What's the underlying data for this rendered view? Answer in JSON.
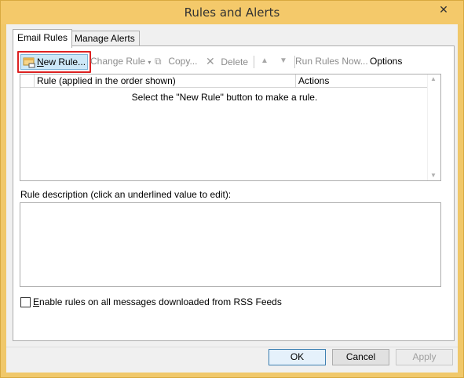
{
  "window": {
    "title": "Rules and Alerts",
    "close_icon": "close-icon"
  },
  "tabs": [
    {
      "label": "Email Rules",
      "active": true
    },
    {
      "label": "Manage Alerts",
      "active": false
    }
  ],
  "toolbar": {
    "new_rule": "New Rule...",
    "change_rule": "Change Rule",
    "copy": "Copy...",
    "delete": "Delete",
    "run_rules_now": "Run Rules Now...",
    "options": "Options"
  },
  "rules_list": {
    "columns": [
      "Rule (applied in the order shown)",
      "Actions"
    ],
    "empty_message": "Select the \"New Rule\" button to make a rule."
  },
  "rule_description": {
    "label": "Rule description (click an underlined value to edit):"
  },
  "rss_checkbox": {
    "label": "Enable rules on all messages downloaded from RSS Feeds",
    "checked": false
  },
  "buttons": {
    "ok": "OK",
    "cancel": "Cancel",
    "apply": "Apply"
  },
  "colors": {
    "frame": "#f4c96a",
    "highlight_border": "#dd2222"
  }
}
